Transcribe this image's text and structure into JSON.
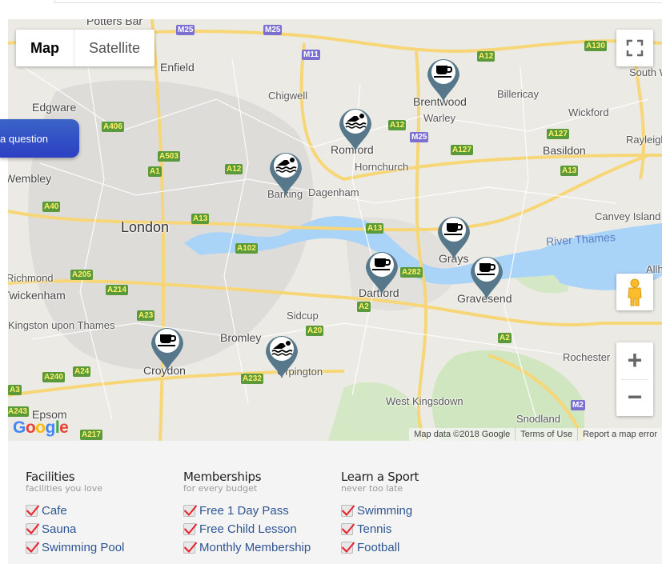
{
  "map": {
    "type_controls": {
      "map_label": "Map",
      "satellite_label": "Satellite",
      "active": "Map"
    },
    "fullscreen_icon": "fullscreen-icon",
    "pegman_icon": "street-view-pegman-icon",
    "zoom_in_label": "+",
    "zoom_out_label": "−",
    "attribution": {
      "data": "Map data ©2018 Google",
      "terms": "Terms of Use",
      "report": "Report a map error"
    },
    "logo": "Google",
    "places": [
      {
        "name": "Potters Bar"
      },
      {
        "name": "Enfield"
      },
      {
        "name": "Chigwell"
      },
      {
        "name": "Edgware"
      },
      {
        "name": "Wembley"
      },
      {
        "name": "London"
      },
      {
        "name": "Romford"
      },
      {
        "name": "Hornchurch"
      },
      {
        "name": "Barking"
      },
      {
        "name": "Dagenham"
      },
      {
        "name": "Brentwood"
      },
      {
        "name": "Warley"
      },
      {
        "name": "Billericay"
      },
      {
        "name": "Wickford"
      },
      {
        "name": "Basildon"
      },
      {
        "name": "Rayleigh"
      },
      {
        "name": "South Woodham Ferrers"
      },
      {
        "name": "Canvey Island"
      },
      {
        "name": "Grays"
      },
      {
        "name": "Dartford"
      },
      {
        "name": "Gravesend"
      },
      {
        "name": "Richmond"
      },
      {
        "name": "Twickenham"
      },
      {
        "name": "Kingston upon Thames"
      },
      {
        "name": "Sidcup"
      },
      {
        "name": "Bromley"
      },
      {
        "name": "Croydon"
      },
      {
        "name": "Orpington"
      },
      {
        "name": "Epsom"
      },
      {
        "name": "West Kingsdown"
      },
      {
        "name": "Rochester"
      },
      {
        "name": "Snodland"
      },
      {
        "name": "Allhallows"
      },
      {
        "name": "River Thames"
      }
    ],
    "roads": [
      "M25",
      "M25",
      "M11",
      "A12",
      "A130",
      "A406",
      "A503",
      "A1",
      "A12",
      "A40",
      "A13",
      "A12",
      "M25",
      "A127",
      "A127",
      "A13",
      "A13",
      "A102",
      "A282",
      "A2",
      "A205",
      "A214",
      "A23",
      "A20",
      "A240",
      "A24",
      "A232",
      "A3",
      "A243",
      "A217",
      "A2",
      "M2"
    ],
    "markers": [
      {
        "place": "Brentwood",
        "icon": "cafe-icon"
      },
      {
        "place": "Romford",
        "icon": "swimming-icon"
      },
      {
        "place": "Barking",
        "icon": "swimming-icon"
      },
      {
        "place": "Grays",
        "icon": "cafe-icon"
      },
      {
        "place": "Dartford",
        "icon": "cafe-icon"
      },
      {
        "place": "Gravesend",
        "icon": "cafe-icon"
      },
      {
        "place": "Croydon",
        "icon": "cafe-icon"
      },
      {
        "place": "Orpington",
        "icon": "swimming-icon"
      }
    ]
  },
  "ask_button": {
    "label": "a question"
  },
  "filters": [
    {
      "title": "Facilities",
      "subtitle": "facilities you love",
      "items": [
        {
          "label": "Cafe",
          "checked": true
        },
        {
          "label": "Sauna",
          "checked": true
        },
        {
          "label": "Swimming Pool",
          "checked": true
        }
      ]
    },
    {
      "title": "Memberships",
      "subtitle": "for every budget",
      "items": [
        {
          "label": "Free 1 Day Pass",
          "checked": true
        },
        {
          "label": "Free Child Lesson",
          "checked": true
        },
        {
          "label": "Monthly Membership",
          "checked": true
        }
      ]
    },
    {
      "title": "Learn a Sport",
      "subtitle": "never too late",
      "items": [
        {
          "label": "Swimming",
          "checked": true
        },
        {
          "label": "Tennis",
          "checked": true
        },
        {
          "label": "Football",
          "checked": true
        }
      ]
    }
  ],
  "colors": {
    "marker": "#56788a",
    "check": "#e8202a",
    "link": "#2e5591",
    "ask_button": "#2c3fc4"
  }
}
